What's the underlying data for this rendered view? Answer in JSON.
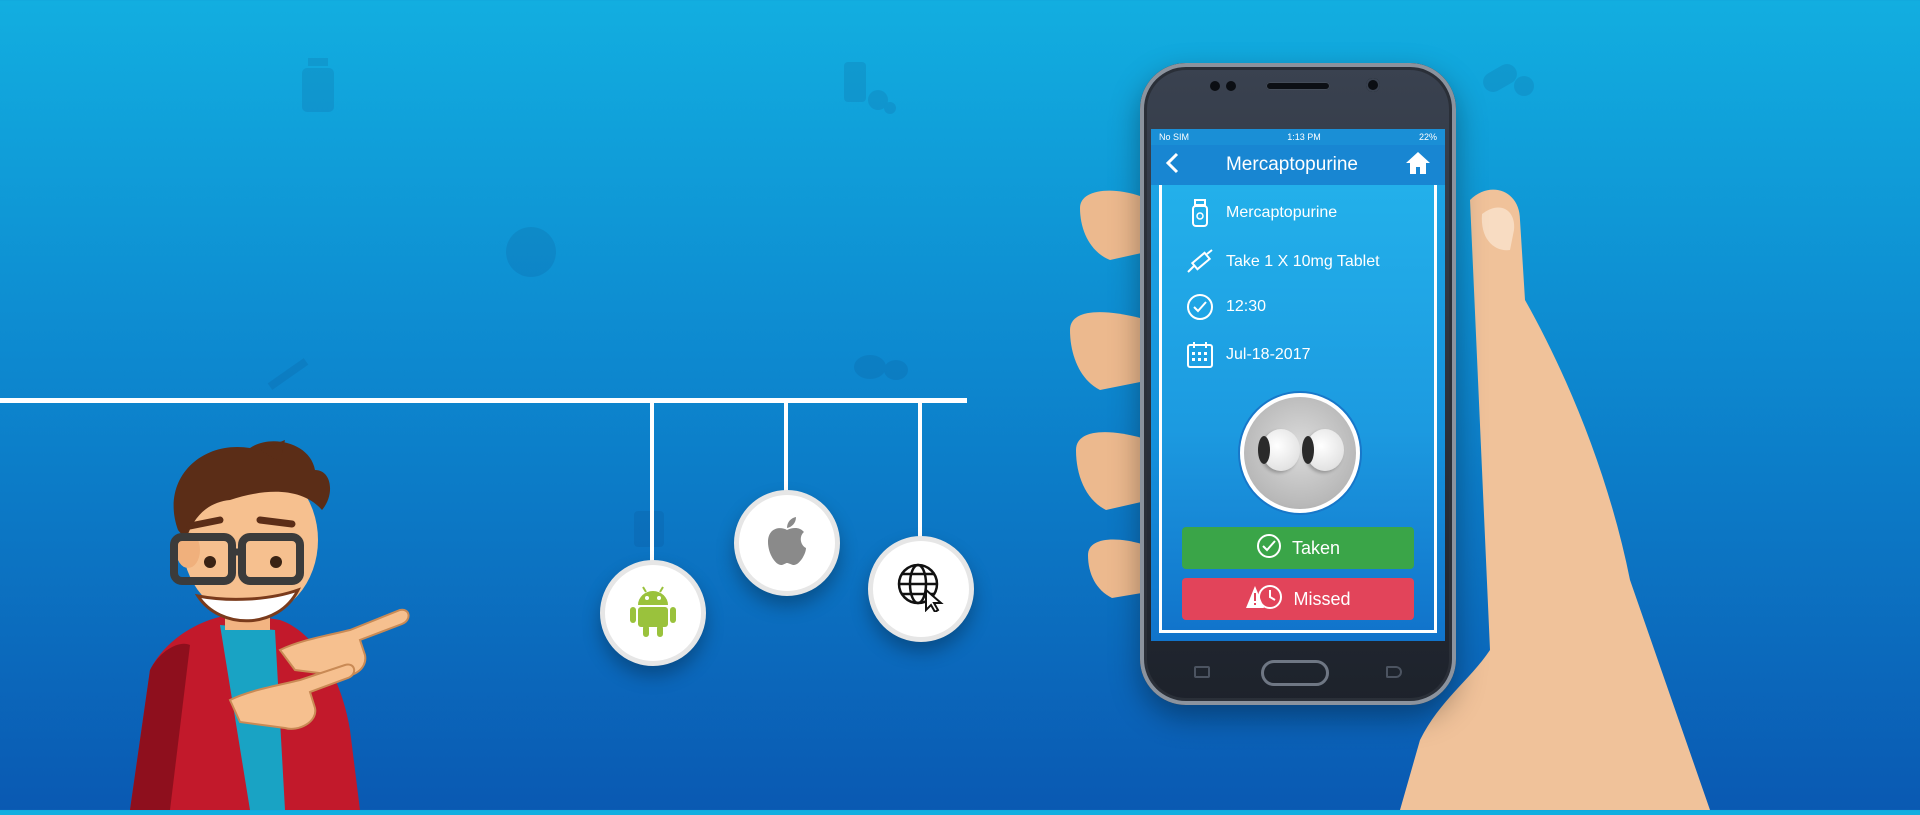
{
  "colors": {
    "background_top": "#12aee0",
    "background_bottom": "#0a59b2",
    "taken": "#3aa548",
    "missed": "#e2445a",
    "android": "#9ac23c"
  },
  "platforms": [
    {
      "name": "android",
      "icon": "android-icon"
    },
    {
      "name": "apple",
      "icon": "apple-icon"
    },
    {
      "name": "web",
      "icon": "globe-cursor-icon"
    }
  ],
  "phone": {
    "status": {
      "carrier": "No SIM",
      "time": "1:13 PM",
      "battery": "22%"
    },
    "nav": {
      "title": "Mercaptopurine",
      "back_icon": "chevron-left-icon",
      "home_icon": "home-icon"
    },
    "details": {
      "medicine": "Mercaptopurine",
      "dosage": "Take 1 X 10mg Tablet",
      "time": "12:30",
      "date": "Jul-18-2017"
    },
    "buttons": {
      "taken": "Taken",
      "missed": "Missed"
    }
  }
}
